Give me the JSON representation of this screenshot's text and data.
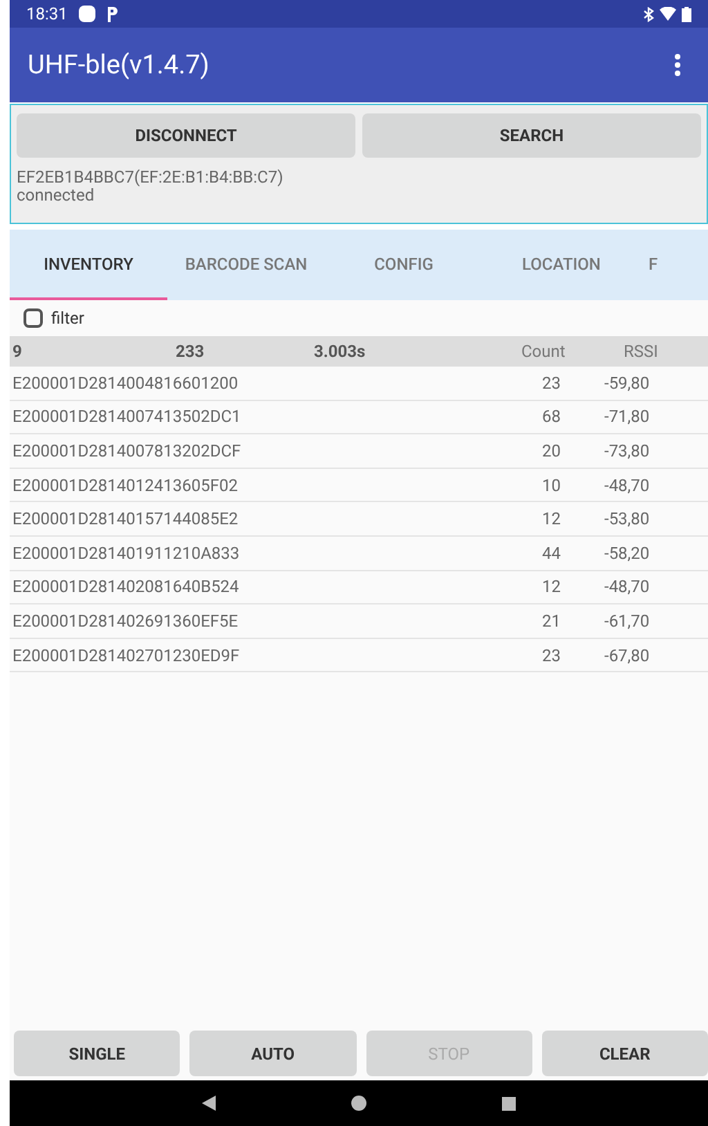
{
  "status_bar": {
    "time": "18:31"
  },
  "app_bar": {
    "title": "UHF-ble(v1.4.7)"
  },
  "connection": {
    "buttons": [
      "DISCONNECT",
      "SEARCH"
    ],
    "device": "EF2EB1B4BBC7(EF:2E:B1:B4:BB:C7)",
    "state": "connected"
  },
  "tabs": [
    {
      "label": "INVENTORY",
      "selected": true
    },
    {
      "label": "BARCODE SCAN",
      "selected": false
    },
    {
      "label": "CONFIG",
      "selected": false
    },
    {
      "label": "LOCATION",
      "selected": false
    },
    {
      "label": "F",
      "selected": false
    }
  ],
  "filter": {
    "label": "filter",
    "checked": false
  },
  "summary": {
    "tags": "9",
    "reads": "233",
    "time": "3.003s",
    "count_header": "Count",
    "rssi_header": "RSSI"
  },
  "rows": [
    {
      "epc": "E200001D2814004816601200",
      "count": "23",
      "rssi": "-59,80"
    },
    {
      "epc": "E200001D2814007413502DC1",
      "count": "68",
      "rssi": "-71,80"
    },
    {
      "epc": "E200001D2814007813202DCF",
      "count": "20",
      "rssi": "-73,80"
    },
    {
      "epc": "E200001D2814012413605F02",
      "count": "10",
      "rssi": "-48,70"
    },
    {
      "epc": "E200001D28140157144085E2",
      "count": "12",
      "rssi": "-53,80"
    },
    {
      "epc": "E200001D281401911210A833",
      "count": "44",
      "rssi": "-58,20"
    },
    {
      "epc": "E200001D281402081640B524",
      "count": "12",
      "rssi": "-48,70"
    },
    {
      "epc": "E200001D281402691360EF5E",
      "count": "21",
      "rssi": "-61,70"
    },
    {
      "epc": "E200001D281402701230ED9F",
      "count": "23",
      "rssi": "-67,80"
    }
  ],
  "actions": [
    {
      "label": "SINGLE",
      "disabled": false
    },
    {
      "label": "AUTO",
      "disabled": false
    },
    {
      "label": "STOP",
      "disabled": true
    },
    {
      "label": "CLEAR",
      "disabled": false
    }
  ]
}
